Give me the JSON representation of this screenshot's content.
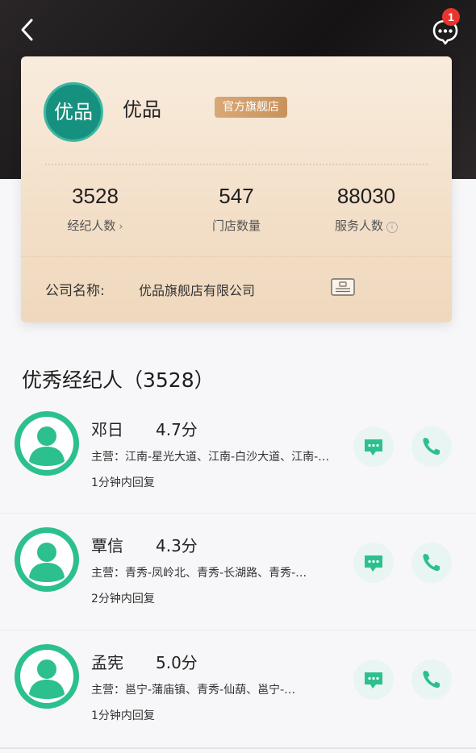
{
  "header": {
    "back_icon": "chevron-left-icon",
    "message_icon": "chat-dots-icon",
    "message_badge": "1"
  },
  "store": {
    "logo_text": "优品",
    "name": "优品",
    "tag": "官方旗舰店",
    "stats": [
      {
        "value": "3528",
        "label": "经纪人数",
        "suffix": "›"
      },
      {
        "value": "547",
        "label": "门店数量"
      },
      {
        "value": "88030",
        "label": "服务人数",
        "suffix_icon": "info-icon"
      }
    ],
    "company_label": "公司名称:",
    "company_name": "优品旗舰店有限公司",
    "license_icon": "license-icon"
  },
  "section_title": "优秀经纪人（3528）",
  "agents": [
    {
      "name": "邓日",
      "score": "4.7分",
      "area": "主营：江南-星光大道、江南-白沙大道、江南-…",
      "reply": "1分钟内回复"
    },
    {
      "name": "覃信",
      "score": "4.3分",
      "area": "主营：青秀-凤岭北、青秀-长湖路、青秀-…",
      "reply": "2分钟内回复"
    },
    {
      "name": "孟宪",
      "score": "5.0分",
      "area": "主营：邕宁-蒲庙镇、青秀-仙葫、邕宁-…",
      "reply": "1分钟内回复"
    }
  ],
  "colors": {
    "accent": "#2cc08e",
    "badge": "#e8352e",
    "logo_bg": "#17917f",
    "tag_bg": "#c8925c"
  }
}
